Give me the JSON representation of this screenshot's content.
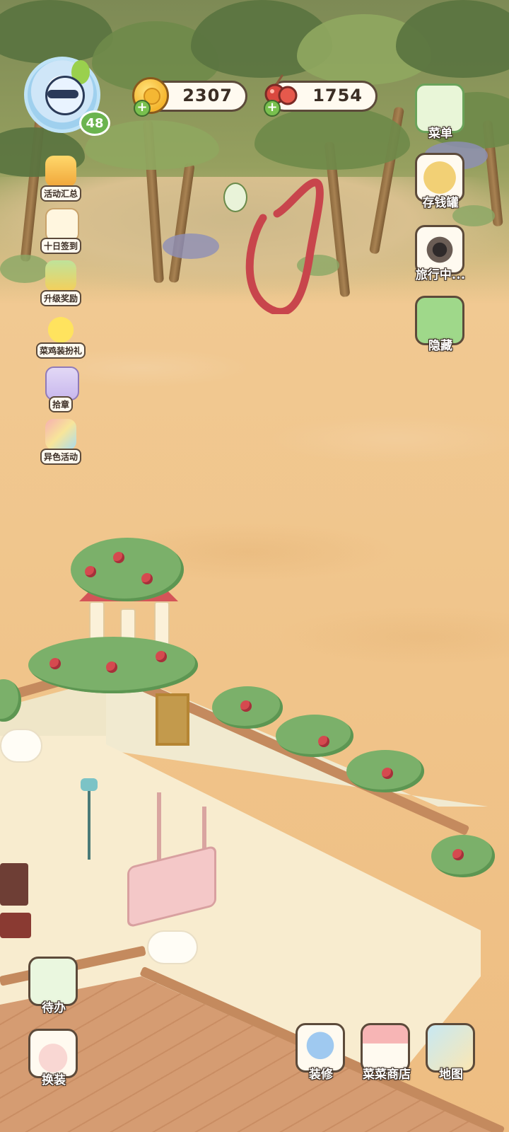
{
  "player": {
    "level": "48"
  },
  "currencies": {
    "coins": {
      "value": "2307"
    },
    "food": {
      "value": "1754"
    }
  },
  "left_menu": [
    {
      "label": "活动汇总",
      "icon": "event-summary-icon"
    },
    {
      "label": "十日签到",
      "icon": "ten-day-checkin-icon"
    },
    {
      "label": "升级奖励",
      "icon": "level-reward-icon"
    },
    {
      "label": "菜鸡装扮礼",
      "icon": "chick-outfit-gift-icon"
    },
    {
      "label": "拾章",
      "icon": "badge-collect-icon"
    },
    {
      "label": "异色活动",
      "icon": "alt-color-event-icon"
    }
  ],
  "right_menu": [
    {
      "label": "菜单",
      "icon": "menu-list-icon"
    },
    {
      "label": "存钱罐",
      "icon": "piggy-bank-icon"
    },
    {
      "label": "旅行中...",
      "icon": "camera-icon"
    },
    {
      "label": "隐藏",
      "icon": "hide-frame-icon"
    }
  ],
  "bottom_left": [
    {
      "label": "待办",
      "icon": "todo-icon"
    },
    {
      "label": "换装",
      "icon": "dress-up-icon"
    }
  ],
  "bottom_right": [
    {
      "label": "装修",
      "icon": "decorate-icon"
    },
    {
      "label": "菜菜商店",
      "icon": "shop-icon"
    },
    {
      "label": "地图",
      "icon": "map-icon"
    }
  ],
  "colors": {
    "accent_outline": "#5c4a3a",
    "level_badge": "#6bb44f",
    "scribble": "#c8454c"
  }
}
